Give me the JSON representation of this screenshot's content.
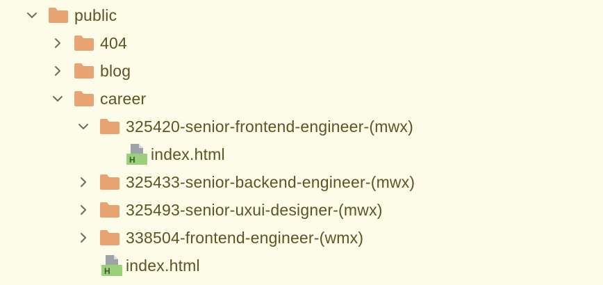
{
  "colors": {
    "background": "#fdfce8",
    "text": "#5a5523",
    "folder": "#e9a474",
    "chevron": "#6e6b5e",
    "file_gray": "#9ea3a7",
    "file_green": "#9ccf7a"
  },
  "tree": {
    "public": {
      "label": "public",
      "state": "expanded",
      "icon": "folder-icon"
    },
    "f404": {
      "label": "404",
      "state": "collapsed",
      "icon": "folder-icon"
    },
    "blog": {
      "label": "blog",
      "state": "collapsed",
      "icon": "folder-icon"
    },
    "career": {
      "label": "career",
      "state": "expanded",
      "icon": "folder-icon"
    },
    "senior_frontend": {
      "label": "325420-senior-frontend-engineer-(mwx)",
      "state": "expanded",
      "icon": "folder-icon"
    },
    "senior_frontend_index": {
      "label": "index.html",
      "icon": "html-file-icon",
      "badge": "H"
    },
    "senior_backend": {
      "label": "325433-senior-backend-engineer-(mwx)",
      "state": "collapsed",
      "icon": "folder-icon"
    },
    "senior_uxui": {
      "label": "325493-senior-uxui-designer-(mwx)",
      "state": "collapsed",
      "icon": "folder-icon"
    },
    "frontend": {
      "label": "338504-frontend-engineer-(wmx)",
      "state": "collapsed",
      "icon": "folder-icon"
    },
    "career_index": {
      "label": "index.html",
      "icon": "html-file-icon",
      "badge": "H"
    }
  }
}
